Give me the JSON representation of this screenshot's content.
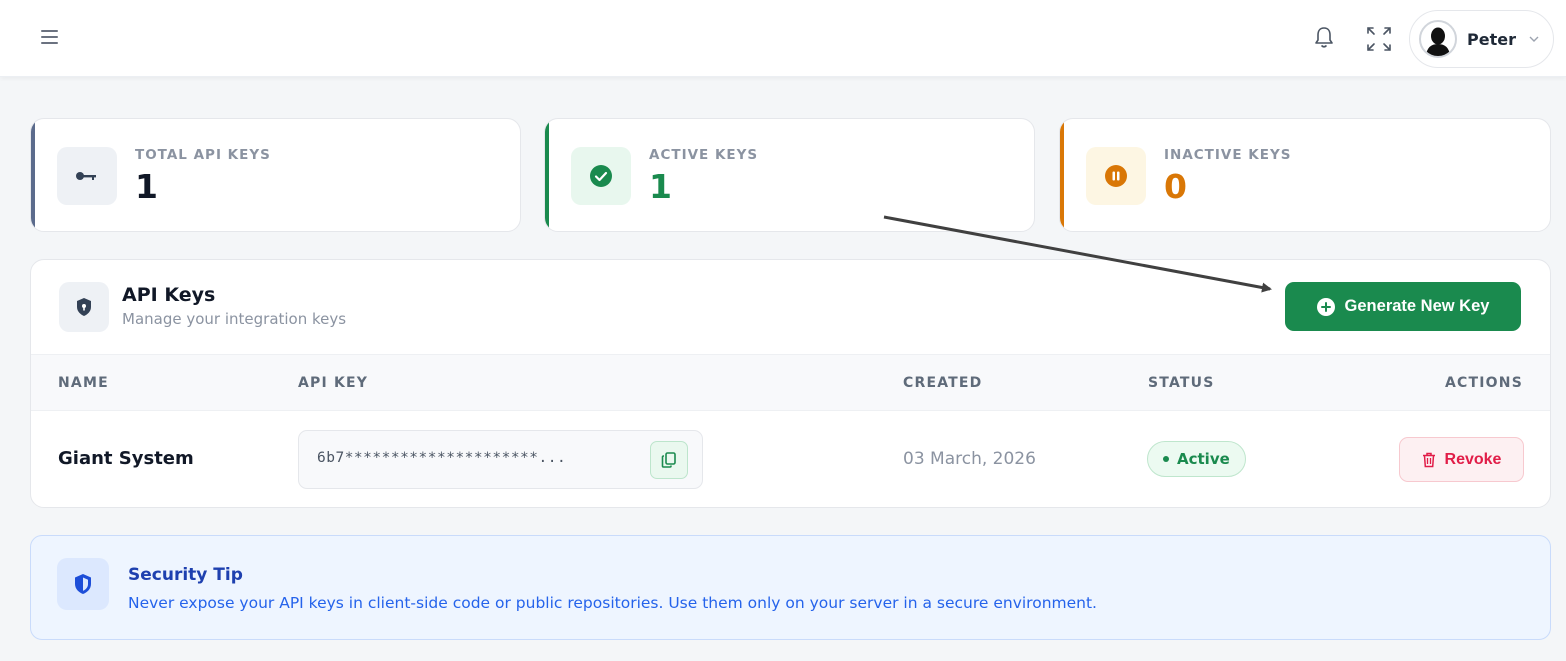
{
  "header": {
    "user_name": "Peter"
  },
  "stats": [
    {
      "label": "TOTAL API KEYS",
      "value": "1",
      "icon": "key-icon",
      "accent": "#5b6b8c",
      "value_color": "#111827"
    },
    {
      "label": "ACTIVE KEYS",
      "value": "1",
      "icon": "check-circle-icon",
      "accent": "#1a8a4e",
      "value_color": "#1a8a4e"
    },
    {
      "label": "INACTIVE KEYS",
      "value": "0",
      "icon": "pause-circle-icon",
      "accent": "#d97706",
      "value_color": "#d97706"
    }
  ],
  "api_keys": {
    "title": "API Keys",
    "subtitle": "Manage your integration keys",
    "generate_label": "Generate New Key",
    "columns": [
      "NAME",
      "API KEY",
      "CREATED",
      "STATUS",
      "ACTIONS"
    ],
    "rows": [
      {
        "name": "Giant System",
        "api_key": "6b7*********************...",
        "created": "03 March, 2026",
        "status": "Active",
        "action": "Revoke"
      }
    ]
  },
  "security_tip": {
    "title": "Security Tip",
    "text": "Never expose your API keys in client-side code or public repositories. Use them only on your server in a secure environment."
  },
  "colors": {
    "primary": "#1a8a4e",
    "danger": "#e11d48",
    "warning": "#d97706",
    "info": "#2563eb"
  }
}
